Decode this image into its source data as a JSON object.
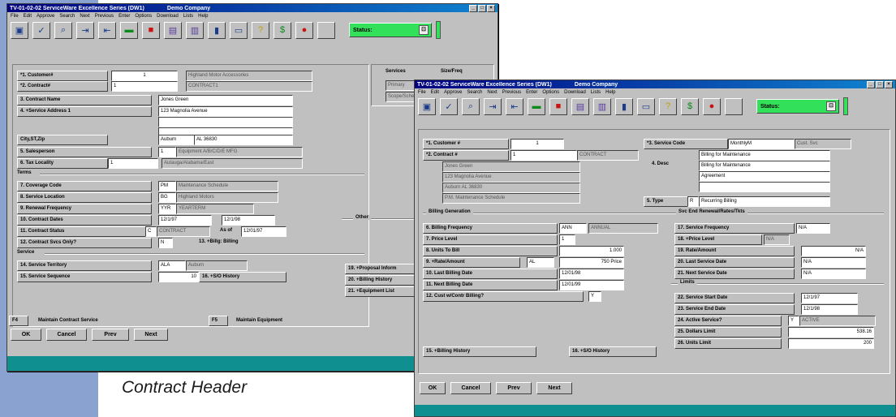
{
  "caption": "Contract Header",
  "window1": {
    "title": "TV-01-02-02   ServiceWare Excellence Series (DW1)",
    "company": "Demo Company",
    "menu": [
      "File",
      "Edit",
      "Approve",
      "Search",
      "Next",
      "Previous",
      "Enter",
      "Options",
      "Download",
      "Lists",
      "Help"
    ],
    "status_label": "Status:",
    "fields": [
      {
        "label": "*1. Customer#",
        "value": "1",
        "extra": "Highland Motor Accessories"
      },
      {
        "label": "*2. Contract#",
        "value": "1",
        "extra": "CONTRACT1"
      },
      {
        "label": "3. Contract Name",
        "value": "Jones Green"
      },
      {
        "label": "4. +Service Address 1",
        "value": "123 Magnolia Avenue"
      },
      {
        "label": "City,ST,Zip",
        "value": "Auburn",
        "extra": "AL 36830"
      },
      {
        "label": "5. Salesperson",
        "value": "1",
        "extra": "Equipment A/B/C/D/E MFG"
      },
      {
        "label": "6. Tax Locality",
        "value": "1",
        "extra": "Autauga/Alabama/East"
      }
    ],
    "terms_title": "Terms",
    "terms": [
      {
        "label": "7. Coverage Code",
        "value": "PM",
        "extra": "Maintenance Schedule"
      },
      {
        "label": "8. Service Location",
        "value": "BG",
        "extra": "Highland Motors"
      },
      {
        "label": "9. Renewal Frequency",
        "value": "YYR",
        "extra": "YEARTERM"
      },
      {
        "label": "10. Contract Dates",
        "value": "12/1/97",
        "extra": "12/1/98"
      },
      {
        "label": "11. Contract Status",
        "value": "C",
        "extra": "CONTRACT",
        "asof_label": "As of",
        "asof": "12/01/97"
      },
      {
        "label": "12. Contract Svcs Only?",
        "value": "N",
        "extra": "13. +Billg: Billing"
      }
    ],
    "service_title": "Service",
    "service": [
      {
        "label": "14. Service Territory",
        "value": "ALA",
        "extra": "Auburn"
      },
      {
        "label": "15. Service Sequence",
        "value": "10",
        "extra": "16. +S/O History"
      }
    ],
    "right_headers": [
      "Services",
      "Size/Freq"
    ],
    "right_values": [
      "Primary",
      "Scope/Sched"
    ],
    "other_title": "Other",
    "other_items": [
      "19. +Proposal Inform",
      "20. +Billing History",
      "21. +Equipment List"
    ],
    "f4": "F4",
    "f4_label": "Maintain Contract Service",
    "f5": "F5",
    "f5_label": "Maintain Equipment",
    "buttons": [
      "OK",
      "Cancel",
      "Prev",
      "Next"
    ]
  },
  "window2": {
    "title": "TV-01-02-02   ServiceWare Excellence Series (DW1)",
    "company": "Demo Company",
    "menu": [
      "File",
      "Edit",
      "Approve",
      "Search",
      "Next",
      "Previous",
      "Enter",
      "Options",
      "Download",
      "Lists",
      "Help"
    ],
    "status_label": "Status:",
    "top_left": [
      {
        "label": "*1. Customer #",
        "value": "1"
      },
      {
        "label": "*2. Contract #",
        "value": "1",
        "extra": "CONTRACT"
      }
    ],
    "address": [
      "Jones Green",
      "123 Magnolia Avenue",
      "Auburn    AL 36830",
      "P.M. Maintenance Schedule"
    ],
    "service_code_label": "*3. Service Code",
    "service_code": "MonthlyM",
    "service_code_extra": "Cust. Svc",
    "desc_label": "4. Desc",
    "desc_lines": [
      "Billing for Maintenance",
      "Billing for Maintenance",
      "Agreement"
    ],
    "type_label": "5. Type",
    "type_value": "R",
    "type_extra": "Recurring Billing",
    "billing_title": "Billing Generation",
    "billing": [
      {
        "label": "6. Billing Frequency",
        "value": "ANN",
        "extra": "ANNUAL"
      },
      {
        "label": "7. Price Level",
        "value": "1"
      },
      {
        "label": "8. Units To Bill",
        "value": "1.000"
      },
      {
        "label": "9. +Rate/Amount",
        "value": "AL",
        "extra": "750 Price"
      },
      {
        "label": "10. Last Billing Date",
        "value": "12/01/98"
      },
      {
        "label": "11. Next Billing Date",
        "value": "12/01/99"
      },
      {
        "label": "12. Cust w/Contr Billing?",
        "value": "Y"
      }
    ],
    "renew_title": "Svc End Renewal/Rates/Tkts",
    "renew": [
      {
        "label": "17. Service Frequency",
        "value": "N/A"
      },
      {
        "label": "18. +Price Level",
        "value": "N/A"
      },
      {
        "label": "19. Rate/Amount",
        "value": "N/A"
      },
      {
        "label": "20. Last Service Date",
        "value": "N/A"
      },
      {
        "label": "21. Next Service Date",
        "value": "N/A"
      }
    ],
    "limits_title": "Limits",
    "limits": [
      {
        "label": "22. Service Start Date",
        "value": "12/1/97"
      },
      {
        "label": "23. Service End Date",
        "value": "12/1/98"
      },
      {
        "label": "24. Active Service?",
        "value": "Y",
        "extra": "ACTIVE"
      },
      {
        "label": "25. Dollars Limit",
        "value": "538.16"
      },
      {
        "label": "26. Units Limit",
        "value": "200"
      }
    ],
    "bottom_buttons": [
      "15. +Billing History",
      "16. +S/O History"
    ],
    "buttons": [
      "OK",
      "Cancel",
      "Prev",
      "Next"
    ]
  }
}
